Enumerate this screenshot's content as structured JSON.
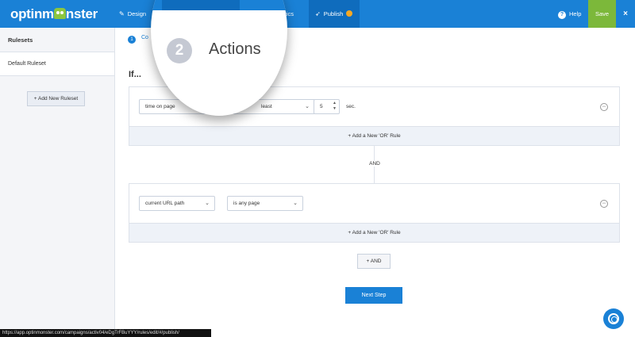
{
  "topbar": {
    "logo": "optinm",
    "logo_suffix": "nster",
    "nav": [
      {
        "label": "Design",
        "icon": "pencil-icon"
      },
      {
        "label": "Analytics",
        "icon": "chart-icon"
      },
      {
        "label": "Publish",
        "icon": "rocket-icon"
      }
    ],
    "help": "Help",
    "help_glyph": "?",
    "save": "Save",
    "close": "×"
  },
  "sidebar": {
    "heading": "Rulesets",
    "items": [
      {
        "label": "Default Ruleset"
      }
    ],
    "add_button": "+ Add New Ruleset"
  },
  "steps": {
    "current_num": "1",
    "current_label": "Co",
    "magnified_num": "2",
    "magnified_label": "Actions"
  },
  "rules": {
    "if_label": "If...",
    "group1": {
      "condition": "time on page",
      "operator": "least",
      "value": "5",
      "unit": "sec.",
      "or_rule": "+ Add a New 'OR' Rule"
    },
    "and_label": "AND",
    "group2": {
      "condition": "current URL path",
      "operator": "is any page",
      "or_rule": "+ Add a New 'OR' Rule"
    },
    "add_and": "+ AND",
    "next_step": "Next Step"
  },
  "status_url": "https://app.optinmonster.com/campaigns/activ04/eDgTrFBuYYY/rules/edit/#/publish/",
  "colors": {
    "primary": "#1a81d6",
    "save": "#7cb83a",
    "sidebar": "#f4f5f8"
  }
}
